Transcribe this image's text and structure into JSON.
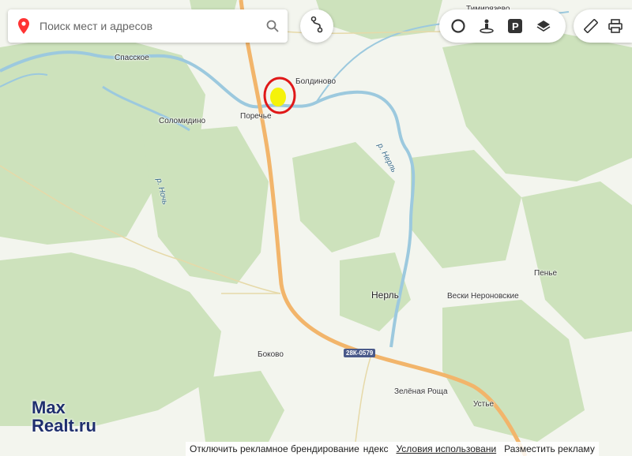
{
  "search": {
    "placeholder": "Поиск мест и адресов"
  },
  "places": {
    "timiryazevo": "Тимирязево",
    "spasskoe": "Спасское",
    "boldinovo": "Болдиново",
    "soloмidino": "Соломидино",
    "poreche": "Поречье",
    "nerl": "Нерль",
    "veski": "Вески Нероновские",
    "pene": "Пенье",
    "bokovo": "Боково",
    "zelenaya_roshcha": "Зелёная Роща",
    "ustye": "Устье"
  },
  "rivers": {
    "nerl": "р. Нерль",
    "noch": "р. Ночь"
  },
  "road_badge": "28К-0579",
  "logo": {
    "line1": "Max",
    "line2": "Realt.ru"
  },
  "footer": {
    "disable_ads": "Отключить рекламное брендирование",
    "brand": "ндекс",
    "terms": "Условия использовани",
    "place_ad": "Разместить рекламу"
  },
  "colors": {
    "forest": "#c9e0b8",
    "open": "#f3f5ee",
    "water": "#9cc9de",
    "road": "#f2b56b",
    "marker": "#e01818",
    "highlight": "#f5f20a"
  }
}
